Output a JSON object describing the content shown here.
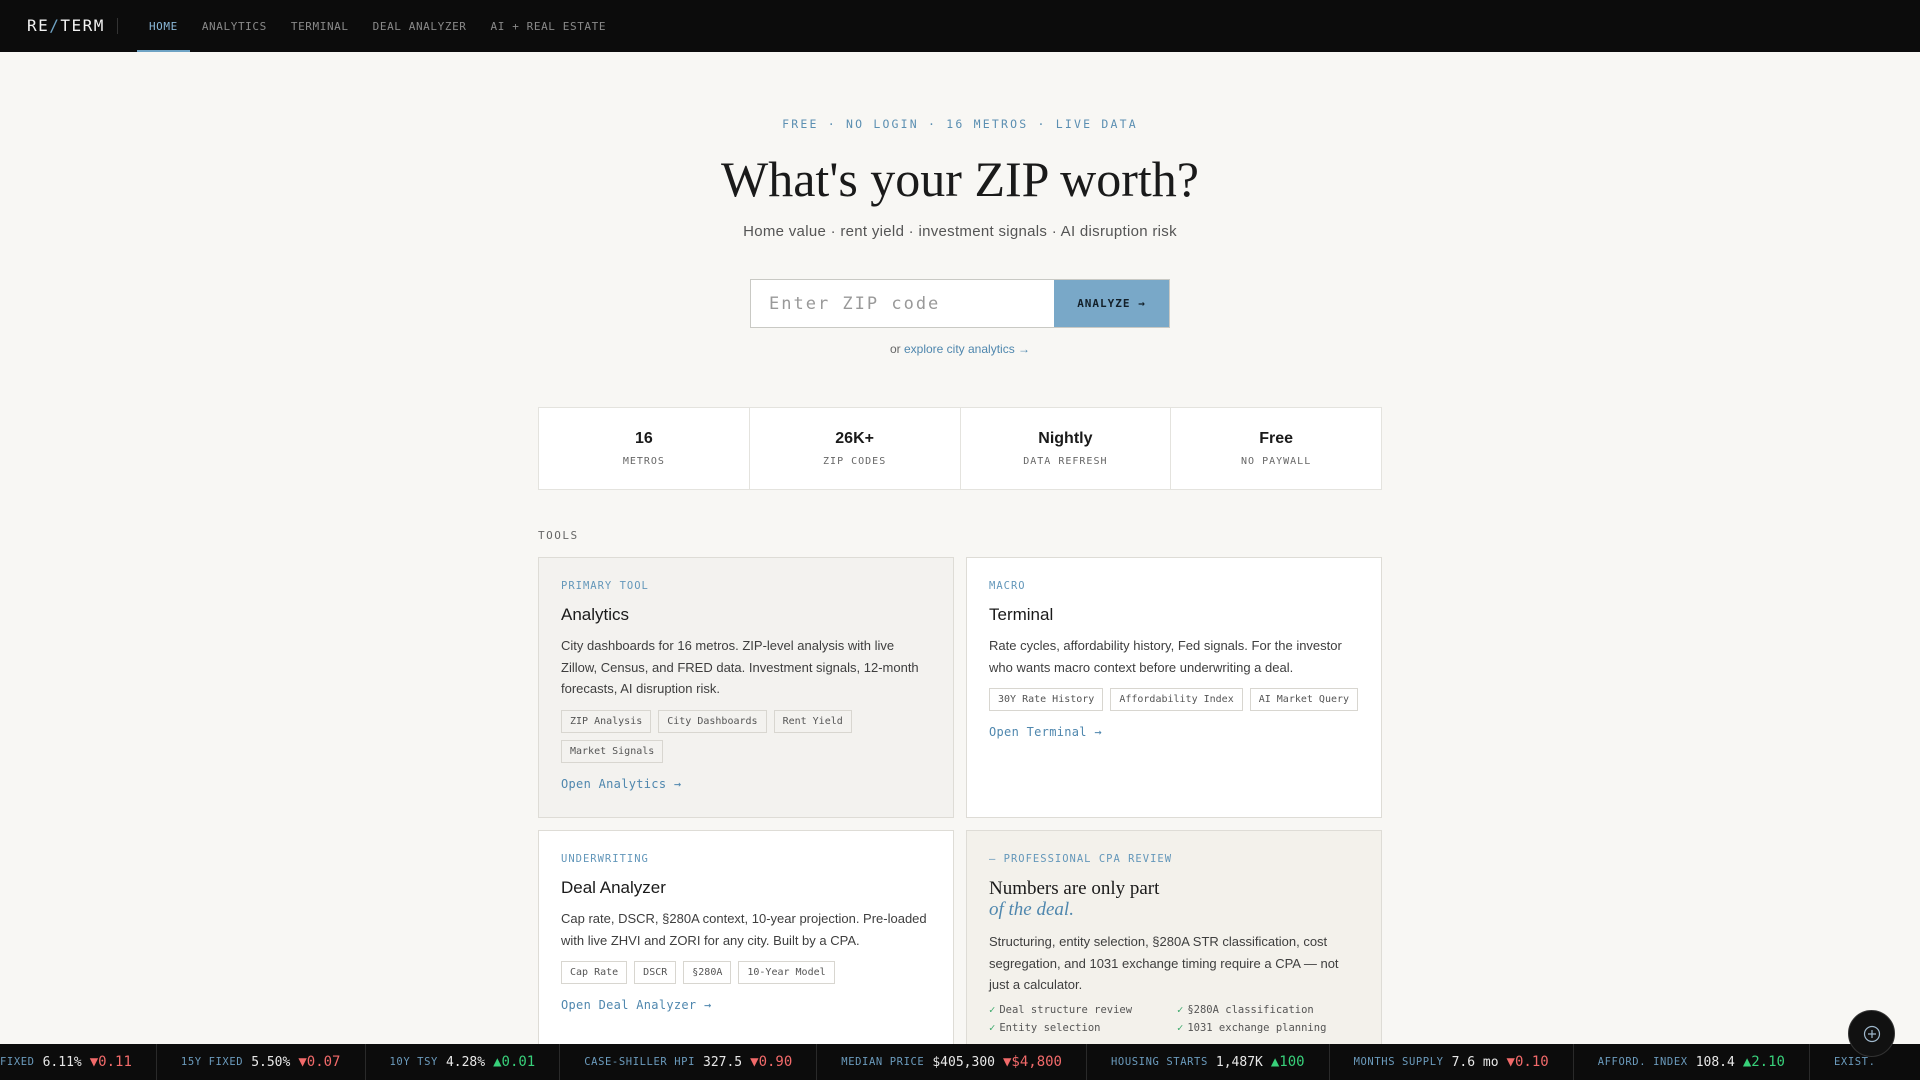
{
  "nav": {
    "logo_left": "RE",
    "logo_slash": "/",
    "logo_right": "TERM",
    "links": [
      "HOME",
      "ANALYTICS",
      "TERMINAL",
      "DEAL ANALYZER",
      "AI + REAL ESTATE"
    ],
    "active": "HOME"
  },
  "hero": {
    "eyebrow": "FREE · NO LOGIN · 16 METROS · LIVE DATA",
    "title": "What's your ZIP worth?",
    "subtitle": "Home value · rent yield · investment signals · AI disruption risk",
    "search_placeholder": "Enter ZIP code",
    "search_value": "",
    "button_label": "ANALYZE →",
    "or_text": "or",
    "explore_link": "explore city analytics →"
  },
  "stats": [
    {
      "value": "16",
      "label": "METROS"
    },
    {
      "value": "26K+",
      "label": "ZIP CODES"
    },
    {
      "value": "Nightly",
      "label": "DATA REFRESH"
    },
    {
      "value": "Free",
      "label": "NO PAYWALL"
    }
  ],
  "tools_label": "TOOLS",
  "cards": {
    "analytics": {
      "eyebrow": "PRIMARY TOOL",
      "title": "Analytics",
      "desc": "City dashboards for 16 metros. ZIP-level analysis with live Zillow, Census, and FRED data. Investment signals, 12-month forecasts, AI disruption risk.",
      "tags": [
        "ZIP Analysis",
        "City Dashboards",
        "Rent Yield",
        "Market Signals"
      ],
      "link": "Open Analytics →"
    },
    "terminal": {
      "eyebrow": "MACRO",
      "title": "Terminal",
      "desc": "Rate cycles, affordability history, Fed signals. For the investor who wants macro context before underwriting a deal.",
      "tags": [
        "30Y Rate History",
        "Affordability Index",
        "AI Market Query"
      ],
      "link": "Open Terminal →"
    },
    "deal": {
      "eyebrow": "UNDERWRITING",
      "title": "Deal Analyzer",
      "desc": "Cap rate, DSCR, §280A context, 10-year projection. Pre-loaded with live ZHVI and ZORI for any city. Built by a CPA.",
      "tags": [
        "Cap Rate",
        "DSCR",
        "§280A",
        "10-Year Model"
      ],
      "link": "Open Deal Analyzer →"
    },
    "cpa": {
      "eyebrow": "— PROFESSIONAL CPA REVIEW",
      "title": "Numbers are only part",
      "title_em": "of the deal.",
      "desc": "Structuring, entity selection, §280A STR classification, cost segregation, and 1031 exchange timing require a CPA — not just a calculator.",
      "checks": [
        "Deal structure review",
        "§280A classification",
        "Entity selection",
        "1031 exchange planning"
      ]
    }
  },
  "ticker": [
    {
      "label": "FIXED",
      "value": "6.11%",
      "change": "▼0.11",
      "dir": "down"
    },
    {
      "label": "15Y FIXED",
      "value": "5.50%",
      "change": "▼0.07",
      "dir": "down"
    },
    {
      "label": "10Y TSY",
      "value": "4.28%",
      "change": "▲0.01",
      "dir": "up"
    },
    {
      "label": "CASE-SHILLER HPI",
      "value": "327.5",
      "change": "▼0.90",
      "dir": "down"
    },
    {
      "label": "MEDIAN PRICE",
      "value": "$405,300",
      "change": "▼$4,800",
      "dir": "down"
    },
    {
      "label": "HOUSING STARTS",
      "value": "1,487K",
      "change": "▲100",
      "dir": "up"
    },
    {
      "label": "MONTHS SUPPLY",
      "value": "7.6 mo",
      "change": "▼0.10",
      "dir": "down"
    },
    {
      "label": "AFFORD. INDEX",
      "value": "108.4",
      "change": "▲2.10",
      "dir": "up"
    },
    {
      "label": "EXIST.",
      "value": "",
      "change": "",
      "dir": "up"
    }
  ],
  "fab_icon": "sparkle-icon"
}
